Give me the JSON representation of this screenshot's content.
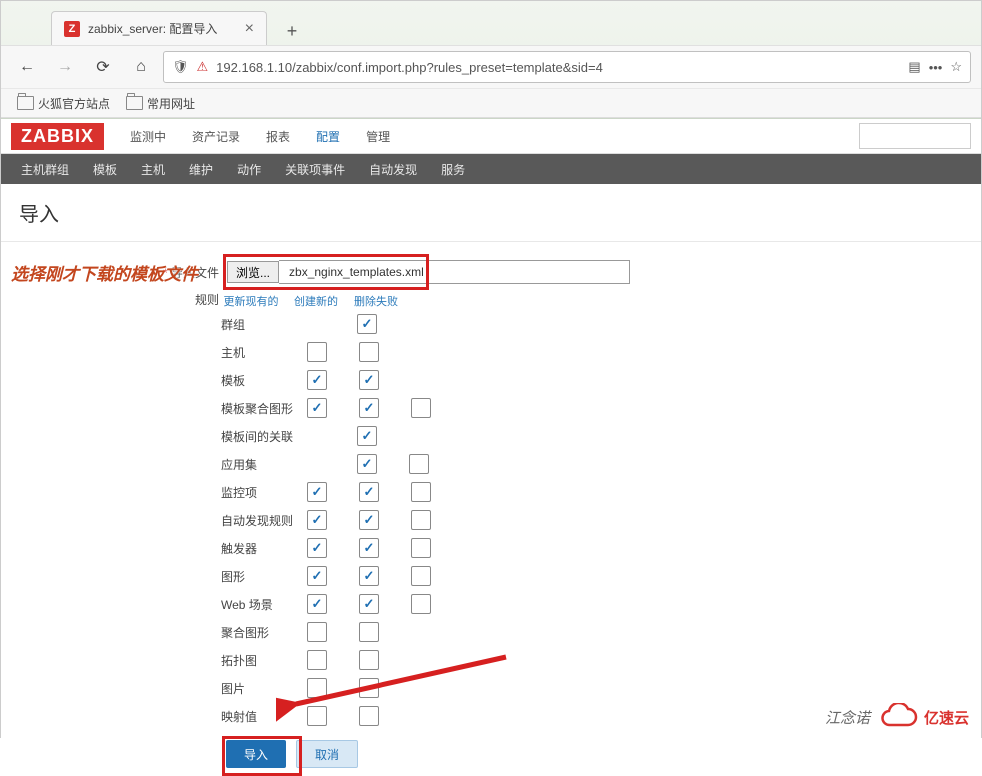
{
  "browser": {
    "tab_title": "zabbix_server: 配置导入",
    "favicon_letter": "Z",
    "url": "192.168.1.10/zabbix/conf.import.php?rules_preset=template&sid=4",
    "bookmarks": [
      "火狐官方站点",
      "常用网址"
    ]
  },
  "zabbix": {
    "logo": "ZABBIX",
    "mainnav": [
      "监测中",
      "资产记录",
      "报表",
      "配置",
      "管理"
    ],
    "mainnav_active_index": 3,
    "subnav": [
      "主机群组",
      "模板",
      "主机",
      "维护",
      "动作",
      "关联项事件",
      "自动发现",
      "服务"
    ],
    "page_title": "导入"
  },
  "form": {
    "file_label": "导入文件",
    "browse_btn": "浏览...",
    "filename": "zbx_nginx_templates.xml",
    "rules_label": "规则",
    "rule_headers": [
      "更新现有的",
      "创建新的",
      "删除失败"
    ],
    "rules": [
      {
        "name": "群组",
        "c": [
          null,
          true,
          null
        ]
      },
      {
        "name": "主机",
        "c": [
          false,
          false,
          null
        ]
      },
      {
        "name": "模板",
        "c": [
          true,
          true,
          null
        ]
      },
      {
        "name": "模板聚合图形",
        "c": [
          true,
          true,
          false
        ]
      },
      {
        "name": "模板间的关联",
        "c": [
          null,
          true,
          null
        ]
      },
      {
        "name": "应用集",
        "c": [
          null,
          true,
          false
        ]
      },
      {
        "name": "监控项",
        "c": [
          true,
          true,
          false
        ]
      },
      {
        "name": "自动发现规则",
        "c": [
          true,
          true,
          false
        ]
      },
      {
        "name": "触发器",
        "c": [
          true,
          true,
          false
        ]
      },
      {
        "name": "图形",
        "c": [
          true,
          true,
          false
        ]
      },
      {
        "name": "Web 场景",
        "c": [
          true,
          true,
          false
        ]
      },
      {
        "name": "聚合图形",
        "c": [
          false,
          false,
          null
        ]
      },
      {
        "name": "拓扑图",
        "c": [
          false,
          false,
          null
        ]
      },
      {
        "name": "图片",
        "c": [
          false,
          false,
          null
        ]
      },
      {
        "name": "映射值",
        "c": [
          false,
          false,
          null
        ]
      }
    ],
    "import_btn": "导入",
    "cancel_btn": "取消"
  },
  "annotations": {
    "file_hint": "选择刚才下载的模板文件",
    "watermark_text": "江念诺",
    "yisu": "亿速云"
  }
}
